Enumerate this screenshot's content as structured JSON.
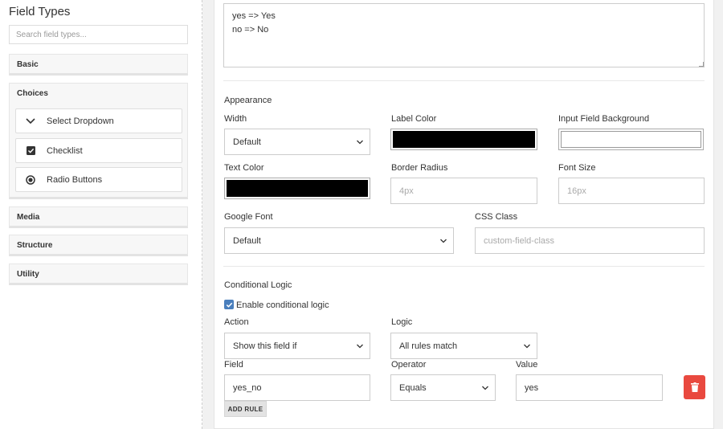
{
  "sidebar": {
    "title": "Field Types",
    "search_placeholder": "Search field types...",
    "categories": {
      "basic": "Basic",
      "choices": "Choices",
      "media": "Media",
      "structure": "Structure",
      "utility": "Utility"
    },
    "choices_items": [
      {
        "label": "Select Dropdown",
        "icon": "chevron-down-icon"
      },
      {
        "label": "Checklist",
        "icon": "checkbox-icon"
      },
      {
        "label": "Radio Buttons",
        "icon": "radio-icon"
      }
    ]
  },
  "options_text": "yes => Yes\nno => No",
  "appearance": {
    "title": "Appearance",
    "width_label": "Width",
    "width_value": "Default",
    "label_color_label": "Label Color",
    "label_color_value": "#000000",
    "input_bg_label": "Input Field Background",
    "input_bg_value": "#ffffff",
    "text_color_label": "Text Color",
    "text_color_value": "#000000",
    "border_radius_label": "Border Radius",
    "border_radius_placeholder": "4px",
    "font_size_label": "Font Size",
    "font_size_placeholder": "16px",
    "google_font_label": "Google Font",
    "google_font_value": "Default",
    "css_class_label": "CSS Class",
    "css_class_placeholder": "custom-field-class"
  },
  "conditional": {
    "title": "Conditional Logic",
    "enable_label": "Enable conditional logic",
    "enabled": true,
    "action_label": "Action",
    "action_value": "Show this field if",
    "logic_label": "Logic",
    "logic_value": "All rules match",
    "field_label": "Field",
    "field_value": "yes_no",
    "operator_label": "Operator",
    "operator_value": "Equals",
    "value_label": "Value",
    "value_value": "yes",
    "add_rule_label": "ADD RULE"
  },
  "colors": {
    "accent": "#4a7fbd",
    "delete": "#e9493f"
  }
}
